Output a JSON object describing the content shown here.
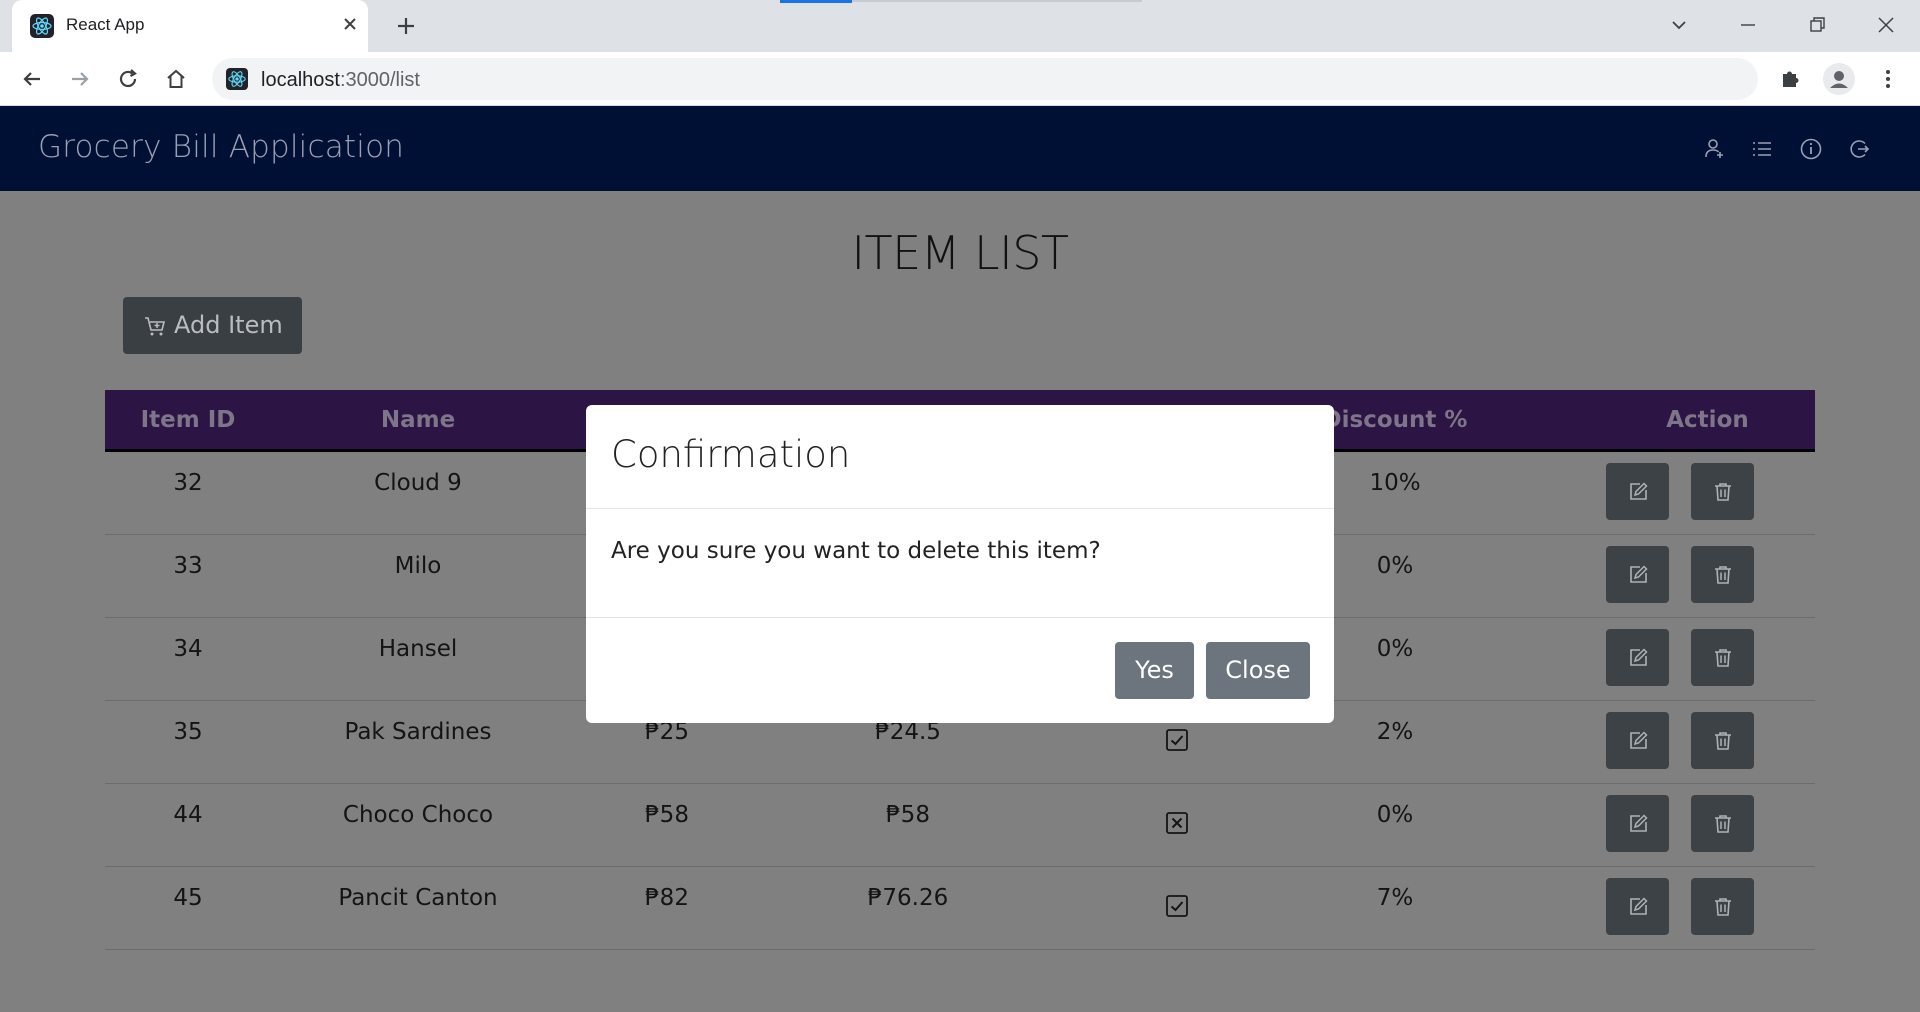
{
  "browser": {
    "tab_title": "React App",
    "url_host": "localhost",
    "url_path": ":3000/list"
  },
  "app": {
    "title": "Grocery Bill Application",
    "header_icons": [
      "user-icon",
      "list-icon",
      "info-icon",
      "logout-icon"
    ]
  },
  "page": {
    "heading": "ITEM LIST",
    "add_button_label": "Add Item"
  },
  "table": {
    "columns": [
      "Item ID",
      "Name",
      "",
      "",
      "",
      "Discount %",
      "Action"
    ],
    "rows": [
      {
        "id": "32",
        "name": "Cloud 9",
        "price": "",
        "discounted": "",
        "discount_applied": true,
        "discount": "10%"
      },
      {
        "id": "33",
        "name": "Milo",
        "price": "",
        "discounted": "",
        "discount_applied": false,
        "discount": "0%"
      },
      {
        "id": "34",
        "name": "Hansel",
        "price": "",
        "discounted": "",
        "discount_applied": false,
        "discount": "0%"
      },
      {
        "id": "35",
        "name": "Pak Sardines",
        "price": "₱25",
        "discounted": "₱24.5",
        "discount_applied": true,
        "discount": "2%"
      },
      {
        "id": "44",
        "name": "Choco Choco",
        "price": "₱58",
        "discounted": "₱58",
        "discount_applied": false,
        "discount": "0%"
      },
      {
        "id": "45",
        "name": "Pancit Canton",
        "price": "₱82",
        "discounted": "₱76.26",
        "discount_applied": true,
        "discount": "7%"
      }
    ]
  },
  "modal": {
    "title": "Confirmation",
    "body": "Are you sure you want to delete this item?",
    "yes_label": "Yes",
    "close_label": "Close"
  },
  "colors": {
    "app_header": "#000f34",
    "table_header": "#2c1444",
    "button_dark": "#3a3f44",
    "modal_button": "#6c757d",
    "overlay": "#808080"
  }
}
